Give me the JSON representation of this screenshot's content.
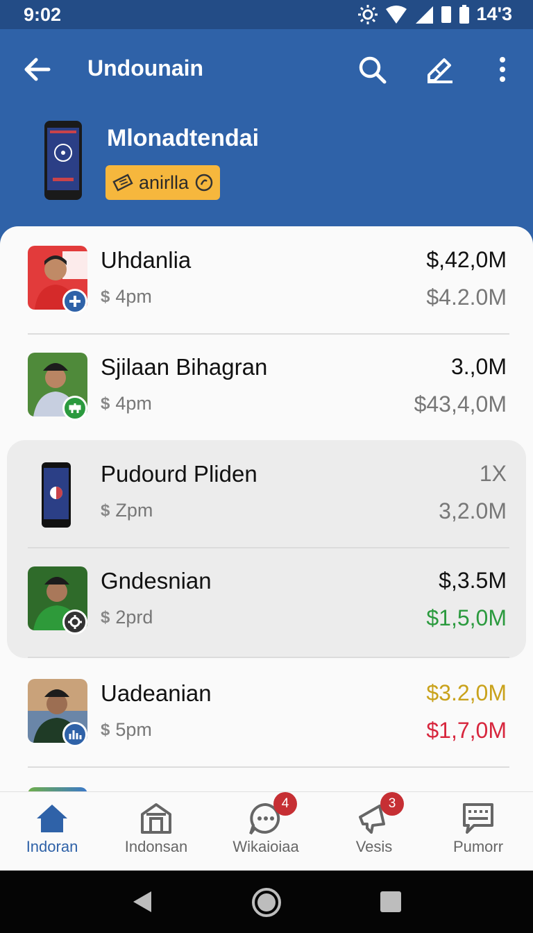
{
  "status": {
    "time": "9:02",
    "battery": "14'3"
  },
  "header": {
    "title": "Undounain"
  },
  "profile": {
    "name": "Mlonadtendai",
    "badge_label": "anirlla"
  },
  "rows": [
    {
      "title": "Uhdanlia",
      "time": "4pm",
      "amount_top": "$,42,0M",
      "amount_bottom": "$4.2.0M",
      "badge_icon": "plus-icon"
    },
    {
      "title": "Sjilaan Bihagran",
      "time": "4pm",
      "amount_top": "3.,0M",
      "amount_bottom": "$43,4,0M",
      "badge_icon": "robot-icon"
    },
    {
      "title": "Pudourd Pliden",
      "time": "Zpm",
      "amount_top": "1X",
      "amount_bottom": "3,2.0M"
    },
    {
      "title": "Gndesnian",
      "time": "2prd",
      "amount_top": "$,3.5M",
      "amount_bottom": "$1,5,0M",
      "badge_icon": "gear-icon"
    },
    {
      "title": "Uadeanian",
      "time": "5pm",
      "amount_top": "$3.2,0M",
      "amount_bottom": "$1,7,0M",
      "badge_icon": "chart-icon"
    }
  ],
  "colors": {
    "positive": "#2b9a3e",
    "warning": "#c9a21b",
    "negative": "#d7263d",
    "accent": "#2f62a8"
  },
  "nav": [
    {
      "label": "Indoran",
      "icon": "home-icon",
      "active": true
    },
    {
      "label": "Indonsan",
      "icon": "store-icon"
    },
    {
      "label": "Wikaioiaa",
      "icon": "chat-icon",
      "badge": "4"
    },
    {
      "label": "Vesis",
      "icon": "megaphone-icon",
      "badge": "3"
    },
    {
      "label": "Pumorr",
      "icon": "message-board-icon"
    }
  ]
}
